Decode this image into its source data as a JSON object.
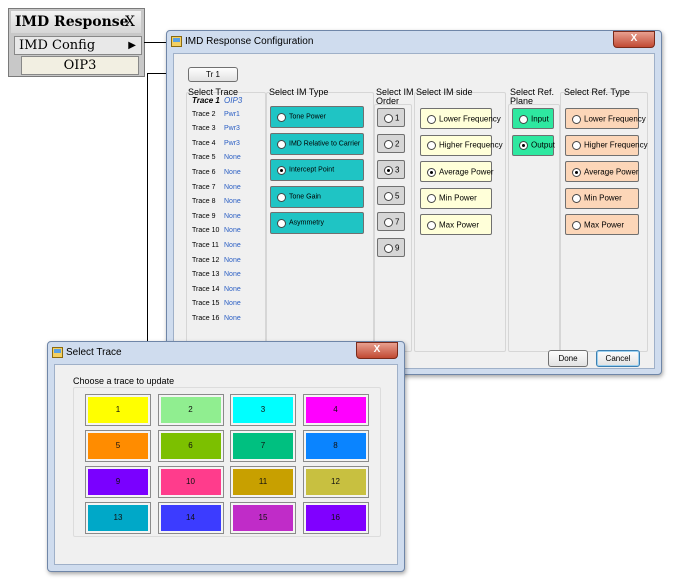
{
  "softkey": {
    "title": "IMD Response",
    "close": "X",
    "menu_label": "IMD Config",
    "menu_arrow": "▶",
    "value": "OIP3"
  },
  "config_window": {
    "title": "IMD Response Configuration",
    "close": "X",
    "tr_button": "Tr 1",
    "select_trace": {
      "title": "Select Trace",
      "rows": [
        {
          "label": "Trace 1",
          "value": "OIP3",
          "active": true
        },
        {
          "label": "Trace 2",
          "value": "Pwr1"
        },
        {
          "label": "Trace 3",
          "value": "Pwr3"
        },
        {
          "label": "Trace 4",
          "value": "Pwr3"
        },
        {
          "label": "Trace 5",
          "value": "None"
        },
        {
          "label": "Trace 6",
          "value": "None"
        },
        {
          "label": "Trace 7",
          "value": "None"
        },
        {
          "label": "Trace 8",
          "value": "None"
        },
        {
          "label": "Trace 9",
          "value": "None"
        },
        {
          "label": "Trace 10",
          "value": "None"
        },
        {
          "label": "Trace 11",
          "value": "None"
        },
        {
          "label": "Trace 12",
          "value": "None"
        },
        {
          "label": "Trace 13",
          "value": "None"
        },
        {
          "label": "Trace 14",
          "value": "None"
        },
        {
          "label": "Trace 15",
          "value": "None"
        },
        {
          "label": "Trace 16",
          "value": "None"
        }
      ]
    },
    "im_type": {
      "title": "Select IM Type",
      "color": "#1fc4c4",
      "options": [
        {
          "label": "Tone Power",
          "selected": false
        },
        {
          "label": "IMD Relative to Carrier",
          "selected": false
        },
        {
          "label": "Intercept Point",
          "selected": true
        },
        {
          "label": "Tone Gain",
          "selected": false
        },
        {
          "label": "Asymmetry",
          "selected": false
        }
      ]
    },
    "im_order": {
      "title_line1": "Select IM",
      "title_line2": "Order",
      "color": "#d6d6d6",
      "options": [
        {
          "label": "1",
          "selected": false
        },
        {
          "label": "2",
          "selected": false
        },
        {
          "label": "3",
          "selected": true
        },
        {
          "label": "5",
          "selected": false
        },
        {
          "label": "7",
          "selected": false
        },
        {
          "label": "9",
          "selected": false
        }
      ]
    },
    "im_side": {
      "title": "Select IM side",
      "color": "#ffffd9",
      "options": [
        {
          "label": "Lower Frequency",
          "selected": false
        },
        {
          "label": "Higher Frequency",
          "selected": false
        },
        {
          "label": "Average Power",
          "selected": true
        },
        {
          "label": "Min Power",
          "selected": false
        },
        {
          "label": "Max Power",
          "selected": false
        }
      ]
    },
    "ref_plane": {
      "title_line1": "Select Ref.",
      "title_line2": "Plane",
      "color": "#2ee8a0",
      "options": [
        {
          "label": "Input",
          "selected": false
        },
        {
          "label": "Output",
          "selected": true
        }
      ]
    },
    "ref_type": {
      "title": "Select Ref. Type",
      "color": "#fcd6b8",
      "options": [
        {
          "label": "Lower Frequency",
          "selected": false
        },
        {
          "label": "Higher Frequency",
          "selected": false
        },
        {
          "label": "Average Power",
          "selected": true
        },
        {
          "label": "Min Power",
          "selected": false
        },
        {
          "label": "Max Power",
          "selected": false
        }
      ]
    },
    "done": "Done",
    "cancel": "Cancel"
  },
  "trace_window": {
    "title": "Select Trace",
    "close": "X",
    "prompt": "Choose a trace to update",
    "tiles": [
      {
        "label": "1",
        "color": "#ffff00"
      },
      {
        "label": "2",
        "color": "#90ee90"
      },
      {
        "label": "3",
        "color": "#00ffff"
      },
      {
        "label": "4",
        "color": "#ff00ff"
      },
      {
        "label": "5",
        "color": "#ff8c00"
      },
      {
        "label": "6",
        "color": "#7cc000"
      },
      {
        "label": "7",
        "color": "#00c080"
      },
      {
        "label": "8",
        "color": "#0a84ff"
      },
      {
        "label": "9",
        "color": "#7a00ff"
      },
      {
        "label": "10",
        "color": "#ff3c8c"
      },
      {
        "label": "11",
        "color": "#c8a000"
      },
      {
        "label": "12",
        "color": "#c8c040"
      },
      {
        "label": "13",
        "color": "#00a8c8"
      },
      {
        "label": "14",
        "color": "#3c3cff"
      },
      {
        "label": "15",
        "color": "#c02cc8"
      },
      {
        "label": "16",
        "color": "#8000ff"
      }
    ]
  }
}
